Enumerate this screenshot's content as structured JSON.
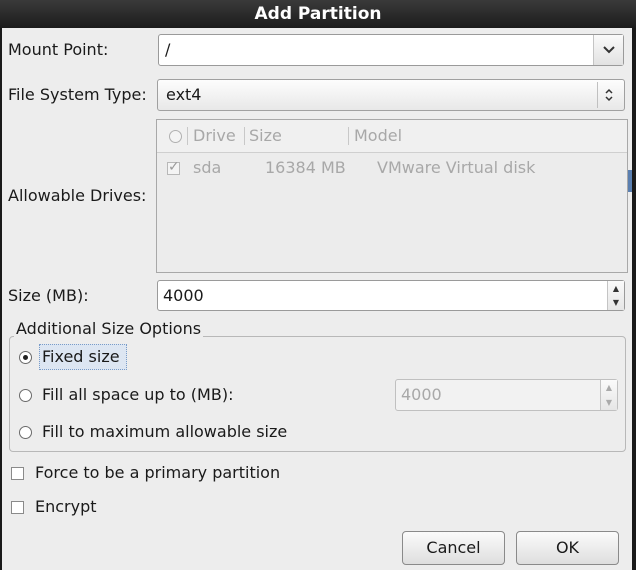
{
  "dialog": {
    "title": "Add Partition"
  },
  "mount_point": {
    "label": "Mount Point:",
    "value": "/",
    "dropdown_icon": "chevron-down-icon"
  },
  "fs_type": {
    "label": "File System Type:",
    "value": "ext4",
    "arrows_icon": "updown-arrows-icon"
  },
  "drives": {
    "label": "Allowable Drives:",
    "columns": [
      "Drive",
      "Size",
      "Model"
    ],
    "rows": [
      {
        "checked": true,
        "drive": "sda",
        "size": "16384 MB",
        "model": "VMware Virtual disk"
      }
    ]
  },
  "size": {
    "label": "Size (MB):",
    "value": "4000"
  },
  "additional": {
    "title": "Additional Size Options",
    "options": [
      {
        "label": "Fixed size",
        "selected": true
      },
      {
        "label": "Fill all space up to (MB):",
        "selected": false
      },
      {
        "label": "Fill to maximum allowable size",
        "selected": false
      }
    ],
    "fill_value": "4000"
  },
  "checkboxes": {
    "primary": {
      "label": "Force to be a primary partition",
      "checked": false
    },
    "encrypt": {
      "label": "Encrypt",
      "checked": false
    }
  },
  "buttons": {
    "cancel": "Cancel",
    "ok": "OK"
  },
  "colors": {
    "titlebar": "#1c1c1c",
    "background": "#ededed",
    "focus": "#dde6f2"
  }
}
